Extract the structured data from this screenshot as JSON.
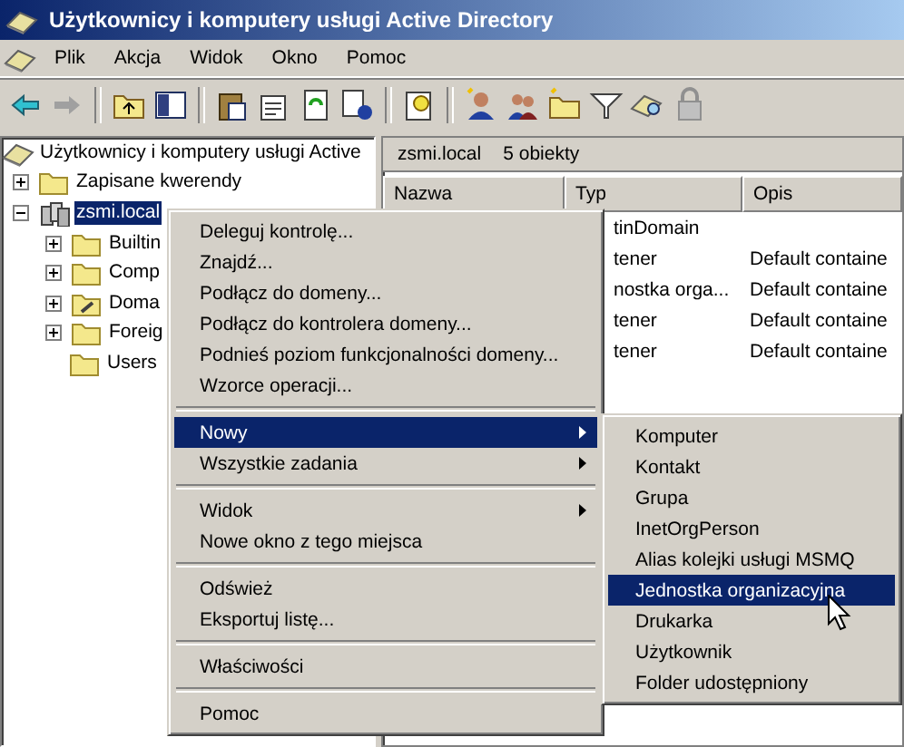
{
  "window": {
    "title": "Użytkownicy i komputery usługi Active Directory"
  },
  "menu_bar": [
    {
      "label": "Plik"
    },
    {
      "label": "Akcja"
    },
    {
      "label": "Widok"
    },
    {
      "label": "Okno"
    },
    {
      "label": "Pomoc"
    }
  ],
  "tree": [
    {
      "label": "Użytkownicy i komputery usługi Active",
      "kind": "snapin",
      "selected": false,
      "children": [
        {
          "label": "Zapisane kwerendy",
          "kind": "folder",
          "expanded": false,
          "selected": false
        },
        {
          "label": "zsmi.local",
          "kind": "domain",
          "expanded": true,
          "selected": true,
          "children": [
            {
              "label": "Builtin",
              "kind": "folder",
              "expanded": false,
              "selected": false
            },
            {
              "label": "Comp",
              "kind": "folder",
              "expanded": false,
              "selected": false
            },
            {
              "label": "Doma",
              "kind": "ou",
              "expanded": false,
              "selected": false
            },
            {
              "label": "Foreig",
              "kind": "folder",
              "expanded": false,
              "selected": false
            },
            {
              "label": "Users",
              "kind": "folder",
              "selected": false
            }
          ]
        }
      ]
    }
  ],
  "list_header": {
    "location": "zsmi.local",
    "count": "5 obiekty"
  },
  "table": {
    "columns": [
      "Nazwa",
      "Typ",
      "Opis"
    ],
    "rows": [
      {
        "type": "tinDomain",
        "description": ""
      },
      {
        "type": "tener",
        "description": "Default containe"
      },
      {
        "type": "nostka orga...",
        "description": "Default containe"
      },
      {
        "type": "tener",
        "description": "Default containe"
      },
      {
        "type": "tener",
        "description": "Default containe"
      }
    ]
  },
  "context_menu": {
    "items": [
      {
        "kind": "item",
        "label": "Deleguj kontrolę...",
        "selected": false,
        "submenu": false
      },
      {
        "kind": "item",
        "label": "Znajdź...",
        "selected": false,
        "submenu": false
      },
      {
        "kind": "item",
        "label": "Podłącz do domeny...",
        "selected": false,
        "submenu": false
      },
      {
        "kind": "item",
        "label": "Podłącz do kontrolera domeny...",
        "selected": false,
        "submenu": false
      },
      {
        "kind": "item",
        "label": "Podnieś poziom funkcjonalności domeny...",
        "selected": false,
        "submenu": false
      },
      {
        "kind": "item",
        "label": "Wzorce operacji...",
        "selected": false,
        "submenu": false
      },
      {
        "kind": "separator"
      },
      {
        "kind": "item",
        "label": "Nowy",
        "selected": true,
        "submenu": true
      },
      {
        "kind": "item",
        "label": "Wszystkie zadania",
        "selected": false,
        "submenu": true
      },
      {
        "kind": "separator"
      },
      {
        "kind": "item",
        "label": "Widok",
        "selected": false,
        "submenu": true
      },
      {
        "kind": "item",
        "label": "Nowe okno z tego miejsca",
        "selected": false,
        "submenu": false
      },
      {
        "kind": "separator"
      },
      {
        "kind": "item",
        "label": "Odśwież",
        "selected": false,
        "submenu": false
      },
      {
        "kind": "item",
        "label": "Eksportuj listę...",
        "selected": false,
        "submenu": false
      },
      {
        "kind": "separator"
      },
      {
        "kind": "item",
        "label": "Właściwości",
        "selected": false,
        "submenu": false
      },
      {
        "kind": "separator"
      },
      {
        "kind": "item",
        "label": "Pomoc",
        "selected": false,
        "submenu": false
      }
    ]
  },
  "submenu": {
    "items": [
      {
        "label": "Komputer",
        "selected": false
      },
      {
        "label": "Kontakt",
        "selected": false
      },
      {
        "label": "Grupa",
        "selected": false
      },
      {
        "label": "InetOrgPerson",
        "selected": false
      },
      {
        "label": "Alias kolejki usługi MSMQ",
        "selected": false
      },
      {
        "label": "Jednostka organizacyjna",
        "selected": true
      },
      {
        "label": "Drukarka",
        "selected": false
      },
      {
        "label": "Użytkownik",
        "selected": false
      },
      {
        "label": "Folder udostępniony",
        "selected": false
      }
    ]
  }
}
